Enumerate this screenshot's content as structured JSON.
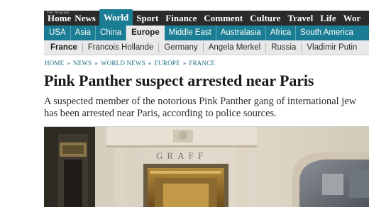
{
  "masthead_tiny": "The Telegraph",
  "section_nav": [
    "Home",
    "News",
    "World",
    "Sport",
    "Finance",
    "Comment",
    "Culture",
    "Travel",
    "Life",
    "Wor"
  ],
  "section_active_index": 2,
  "region_nav": [
    "USA",
    "Asia",
    "China",
    "Europe",
    "Middle East",
    "Australasia",
    "Africa",
    "South America"
  ],
  "region_active_index": 3,
  "topic_nav": [
    "France",
    "Francois Hollande",
    "Germany",
    "Angela Merkel",
    "Russia",
    "Vladimir Putin"
  ],
  "breadcrumb": [
    "Home",
    "News",
    "World News",
    "Europe",
    "France"
  ],
  "breadcrumb_separator": "»",
  "article": {
    "headline": "Pink Panther suspect arrested near Paris",
    "standfirst_line1": "A suspected member of the notorious Pink Panther gang of international jew",
    "standfirst_line2": "has been arrested near Paris, according to police sources."
  },
  "photo": {
    "sign_text": "GRAFF"
  },
  "colors": {
    "section_bar": "#2b2b2b",
    "accent_teal": "#1a7d93",
    "topic_bar": "#e9e9e9",
    "link_teal": "#1a6d86"
  }
}
